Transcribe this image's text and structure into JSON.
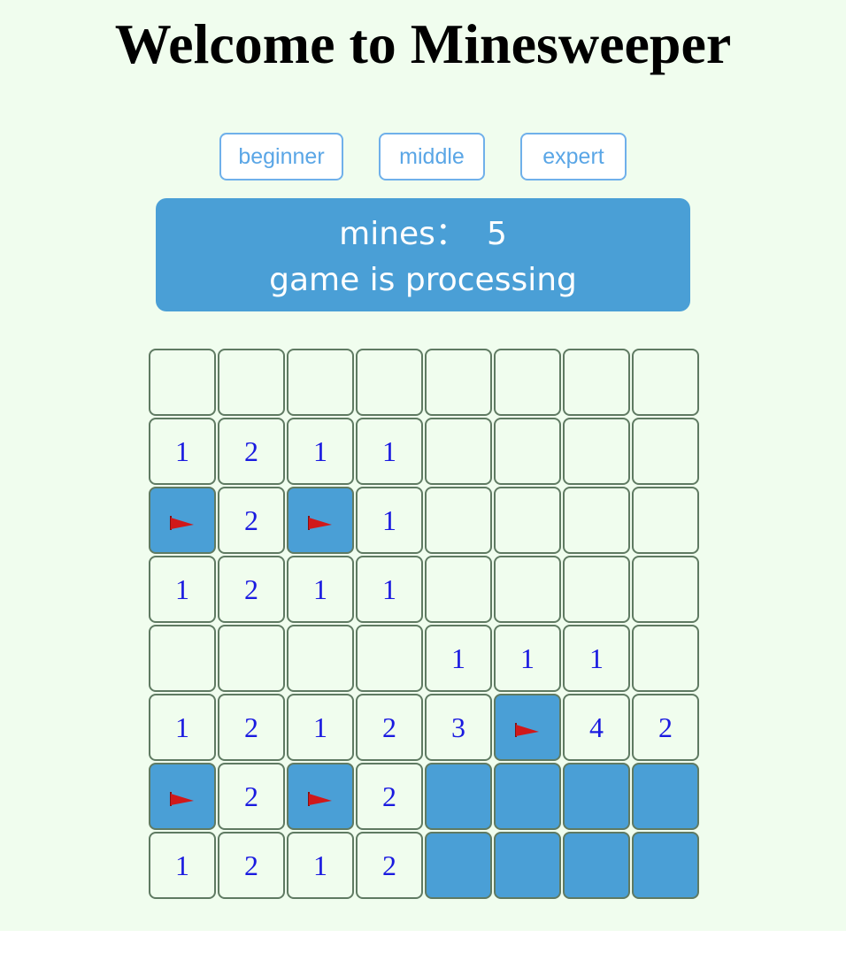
{
  "title": "Welcome to Minesweeper",
  "levels": {
    "beginner": "beginner",
    "middle": "middle",
    "expert": "expert"
  },
  "status": {
    "mines_label": "mines：",
    "mines_count": "5",
    "state": "game is processing"
  },
  "colors": {
    "background": "#f0fdee",
    "accent": "#4a9fd6",
    "number": "#1a1ae0",
    "flag": "#d0181a"
  },
  "board": {
    "rows": 8,
    "cols": 8,
    "cells": [
      [
        " ",
        " ",
        " ",
        " ",
        " ",
        " ",
        " ",
        " "
      ],
      [
        "1",
        "2",
        "1",
        "1",
        " ",
        " ",
        " ",
        " "
      ],
      [
        "F",
        "2",
        "F",
        "1",
        " ",
        " ",
        " ",
        " "
      ],
      [
        "1",
        "2",
        "1",
        "1",
        " ",
        " ",
        " ",
        " "
      ],
      [
        " ",
        " ",
        " ",
        " ",
        "1",
        "1",
        "1",
        " "
      ],
      [
        "1",
        "2",
        "1",
        "2",
        "3",
        "F",
        "4",
        "2"
      ],
      [
        "F",
        "2",
        "F",
        "2",
        "#",
        "#",
        "#",
        "#"
      ],
      [
        "1",
        "2",
        "1",
        "2",
        "#",
        "#",
        "#",
        "#"
      ]
    ],
    "legend": {
      " ": "revealed-empty",
      "F": "flag-icon",
      "#": "covered"
    }
  }
}
